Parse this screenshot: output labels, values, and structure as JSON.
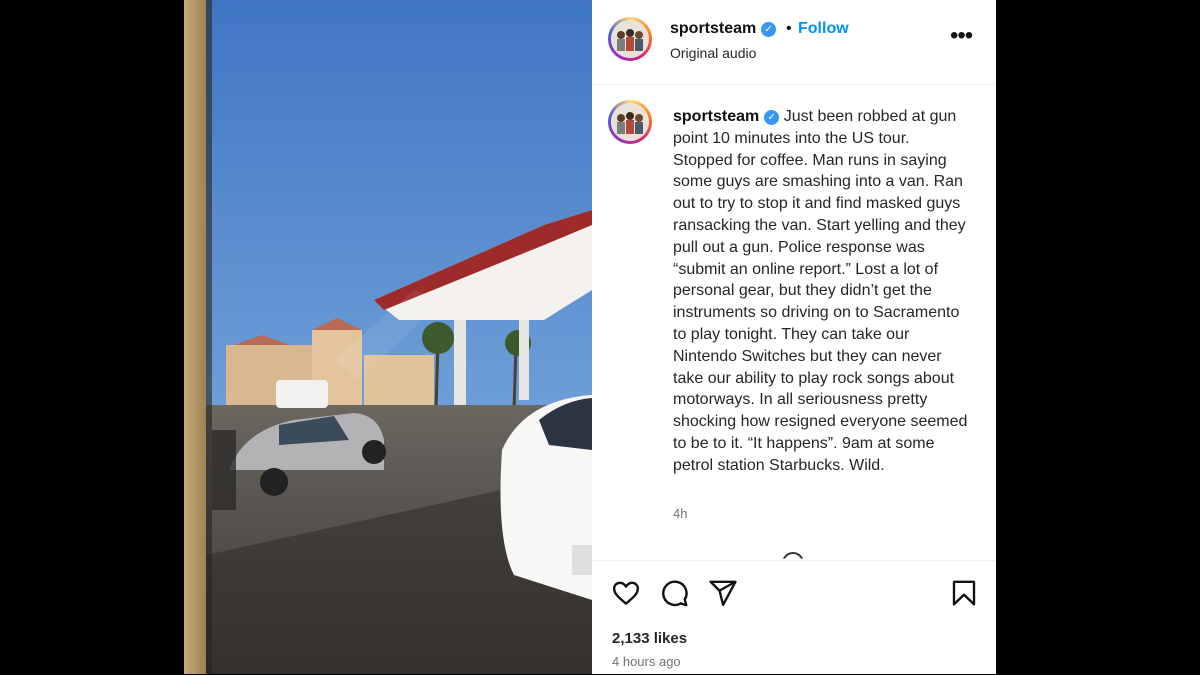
{
  "colors": {
    "accent": "#0095f6",
    "verified": "#3897f0",
    "text": "#262626",
    "muted": "#737373"
  },
  "media": {
    "alt_icon": "photo-gas-station-reflection"
  },
  "header": {
    "username": "sportsteam",
    "separator": "•",
    "follow_label": "Follow",
    "audio_label": "Original audio",
    "more_icon": "more-options-icon",
    "more_label": "•••"
  },
  "caption": {
    "username": "sportsteam",
    "text": "Just been robbed at gun point 10 minutes into the US tour. Stopped for coffee. Man runs in saying some guys are smashing into a van. Ran out to try to stop it and find masked guys ransacking the van. Start yelling and they pull out a gun. Police response was “submit an online report.” Lost a lot of personal gear, but they didn’t get the instruments so driving on to Sacramento to play tonight. They can take our Nintendo Switches but they can never take our ability to play rock songs about motorways. In all seriousness pretty shocking how resigned everyone seemed to be to it. “It happens”. 9am at some petrol station Starbucks. Wild.",
    "time": "4h"
  },
  "actions": {
    "icons": [
      "heart-icon",
      "comment-icon",
      "share-icon",
      "bookmark-icon"
    ]
  },
  "stats": {
    "likes": "2,133 likes",
    "posted": "4 hours ago"
  }
}
